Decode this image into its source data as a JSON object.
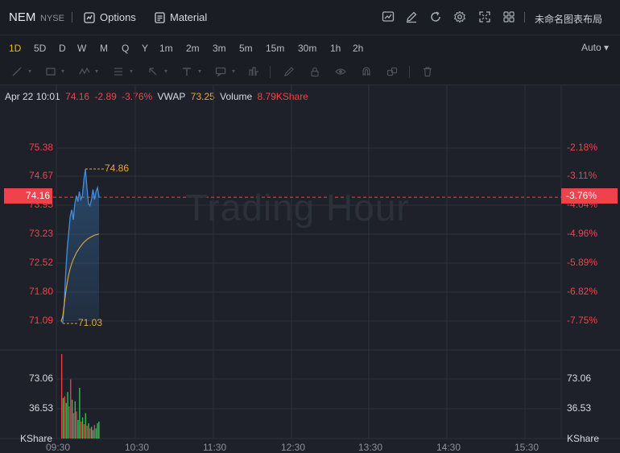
{
  "header": {
    "symbol": "NEM",
    "exchange": "NYSE",
    "options_label": "Options",
    "material_label": "Material",
    "layout_name": "未命名图表布局",
    "icons": [
      "chart-icon",
      "edit-icon",
      "refresh-icon",
      "settings-icon",
      "fullscreen-icon",
      "grid-icon"
    ]
  },
  "timeframes": [
    "1D",
    "5D",
    "D",
    "W",
    "M",
    "Q",
    "Y",
    "1m",
    "2m",
    "3m",
    "5m",
    "15m",
    "30m",
    "1h",
    "2h"
  ],
  "active_timeframe": "1D",
  "auto_label": "Auto",
  "info": {
    "datetime": "Apr 22 10:01",
    "price": "74.16",
    "change": "-2.89",
    "change_pct": "-3.76%",
    "vwap_label": "VWAP",
    "vwap_value": "73.25",
    "volume_label": "Volume",
    "volume_value": "8.79KShare"
  },
  "colors": {
    "down": "#f0424b",
    "up": "#34c759",
    "price_line": "#3f8fe0",
    "vwap_line": "#e0a93a",
    "background": "#1e2129"
  },
  "watermark": "Trading Hour",
  "chart_data": {
    "type": "line",
    "price_axis": [
      "75.38",
      "74.67",
      "73.95",
      "73.23",
      "72.52",
      "71.80",
      "71.09"
    ],
    "pct_axis": [
      "-2.18%",
      "-3.11%",
      "-4.04%",
      "-4.96%",
      "-5.89%",
      "-6.82%",
      "-7.75%"
    ],
    "current_price": "74.16",
    "current_pct": "-3.76%",
    "high_label": "74.86",
    "low_label": "71.03",
    "volume_axis": [
      "73.06",
      "36.53",
      "KShare"
    ],
    "time_axis": [
      "09:30",
      "10:30",
      "11:30",
      "12:30",
      "13:30",
      "14:30",
      "15:30"
    ],
    "ylim": [
      71.03,
      75.38
    ],
    "price_series": [
      71.09,
      71.05,
      71.5,
      72.3,
      72.9,
      73.3,
      73.7,
      73.85,
      73.6,
      74.0,
      74.2,
      74.05,
      74.3,
      74.1,
      74.2,
      74.6,
      74.86,
      74.4,
      74.0,
      73.95,
      74.1,
      74.35,
      74.1,
      74.3,
      74.4,
      74.16
    ],
    "vwap_series": [
      71.09,
      71.2,
      71.5,
      71.8,
      72.05,
      72.25,
      72.4,
      72.52,
      72.62,
      72.7,
      72.78,
      72.84,
      72.9,
      72.95,
      73.0,
      73.04,
      73.08,
      73.11,
      73.14,
      73.16,
      73.18,
      73.2,
      73.22,
      73.23,
      73.24,
      73.25
    ],
    "volume_series": [
      100,
      48,
      50,
      42,
      55,
      38,
      70,
      46,
      30,
      44,
      32,
      22,
      60,
      20,
      25,
      17,
      30,
      15,
      18,
      12,
      14,
      10,
      16,
      12,
      18,
      20
    ],
    "volume_max": 100,
    "volume_colors": [
      "down",
      "up",
      "down",
      "up",
      "up",
      "down",
      "down",
      "up",
      "down",
      "up",
      "down",
      "up",
      "up",
      "down",
      "up",
      "down",
      "up",
      "down",
      "up",
      "down",
      "up",
      "up",
      "down",
      "up",
      "up",
      "up"
    ]
  }
}
